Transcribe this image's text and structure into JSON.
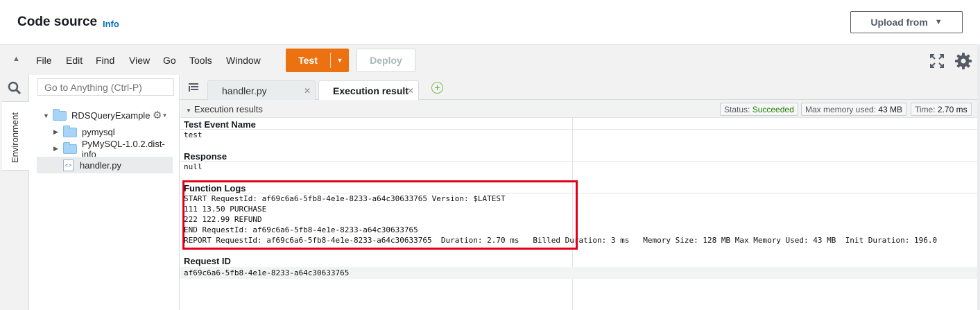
{
  "header": {
    "title": "Code source",
    "info_link": "Info",
    "upload_button": "Upload from"
  },
  "toolbar": {
    "menus": [
      "File",
      "Edit",
      "Find",
      "View",
      "Go",
      "Tools",
      "Window"
    ],
    "test_button": "Test",
    "deploy_button": "Deploy"
  },
  "sidebar": {
    "search_placeholder": "Go to Anything (Ctrl-P)",
    "environment_tab": "Environment",
    "tree": {
      "root": "RDSQueryExample",
      "folders": [
        "pymysql",
        "PyMySQL-1.0.2.dist-info"
      ],
      "file": "handler.py"
    }
  },
  "tabs": [
    {
      "label": "handler.py",
      "active": false
    },
    {
      "label": "Execution result",
      "active": true
    }
  ],
  "results": {
    "header": "Execution results",
    "status_label": "Status:",
    "status_value": "Succeeded",
    "memory_label": "Max memory used:",
    "memory_value": "43 MB",
    "time_label": "Time:",
    "time_value": "2.70 ms",
    "test_event_title": "Test Event Name",
    "test_event_value": "test",
    "response_title": "Response",
    "response_value": "null",
    "logs_title": "Function Logs",
    "logs": [
      "START RequestId: af69c6a6-5fb8-4e1e-8233-a64c30633765 Version: $LATEST",
      "111 13.50 PURCHASE",
      "222 122.99 REFUND",
      "END RequestId: af69c6a6-5fb8-4e1e-8233-a64c30633765",
      "REPORT RequestId: af69c6a6-5fb8-4e1e-8233-a64c30633765  Duration: 2.70 ms   Billed Duration: 3 ms   Memory Size: 128 MB Max Memory Used: 43 MB  Init Duration: 196.0"
    ],
    "request_id_title": "Request ID",
    "request_id_value": "af69c6a6-5fb8-4e1e-8233-a64c30633765"
  },
  "colors": {
    "accent_orange": "#ec7211",
    "link_blue": "#0073bb",
    "success_green": "#1d8102",
    "highlight_red": "#e3001b"
  }
}
